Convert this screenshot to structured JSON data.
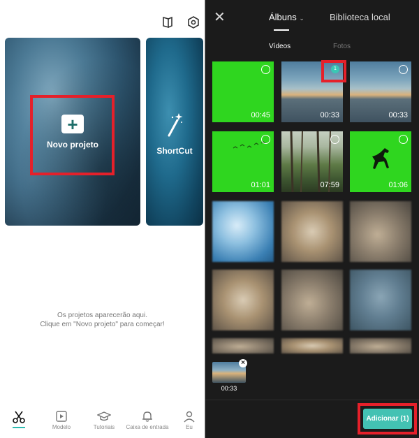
{
  "left": {
    "cards": {
      "new_project_label": "Novo projeto",
      "shortcut_label": "ShortCut"
    },
    "empty_message": {
      "line1": "Os projetos aparecerão aqui.",
      "line2": "Clique em \"Novo projeto\" para começar!"
    },
    "bottom_nav": [
      {
        "label": "",
        "icon": "scissors-icon",
        "active": true
      },
      {
        "label": "Modelo",
        "icon": "template-icon"
      },
      {
        "label": "Tutoriais",
        "icon": "graduation-cap-icon"
      },
      {
        "label": "Caixa de entrada",
        "icon": "bell-icon"
      },
      {
        "label": "Eu",
        "icon": "user-icon"
      }
    ]
  },
  "right": {
    "tabs": {
      "albums": "Álbuns",
      "local_library": "Biblioteca local"
    },
    "subtabs": {
      "videos": "Vídeos",
      "photos": "Fotos"
    },
    "media": [
      {
        "duration": "00:45",
        "selected": false
      },
      {
        "duration": "00:33",
        "selected": true,
        "selection_number": "1"
      },
      {
        "duration": "00:33",
        "selected": false
      },
      {
        "duration": "01:01",
        "selected": false
      },
      {
        "duration": "07:59",
        "selected": false
      },
      {
        "duration": "01:06",
        "selected": false
      }
    ],
    "tray": {
      "duration": "00:33"
    },
    "add_button": "Adicionar (1)"
  },
  "colors": {
    "accent": "#43c2b3",
    "highlight": "#e5202a",
    "dark_bg": "#1b1b1b"
  }
}
